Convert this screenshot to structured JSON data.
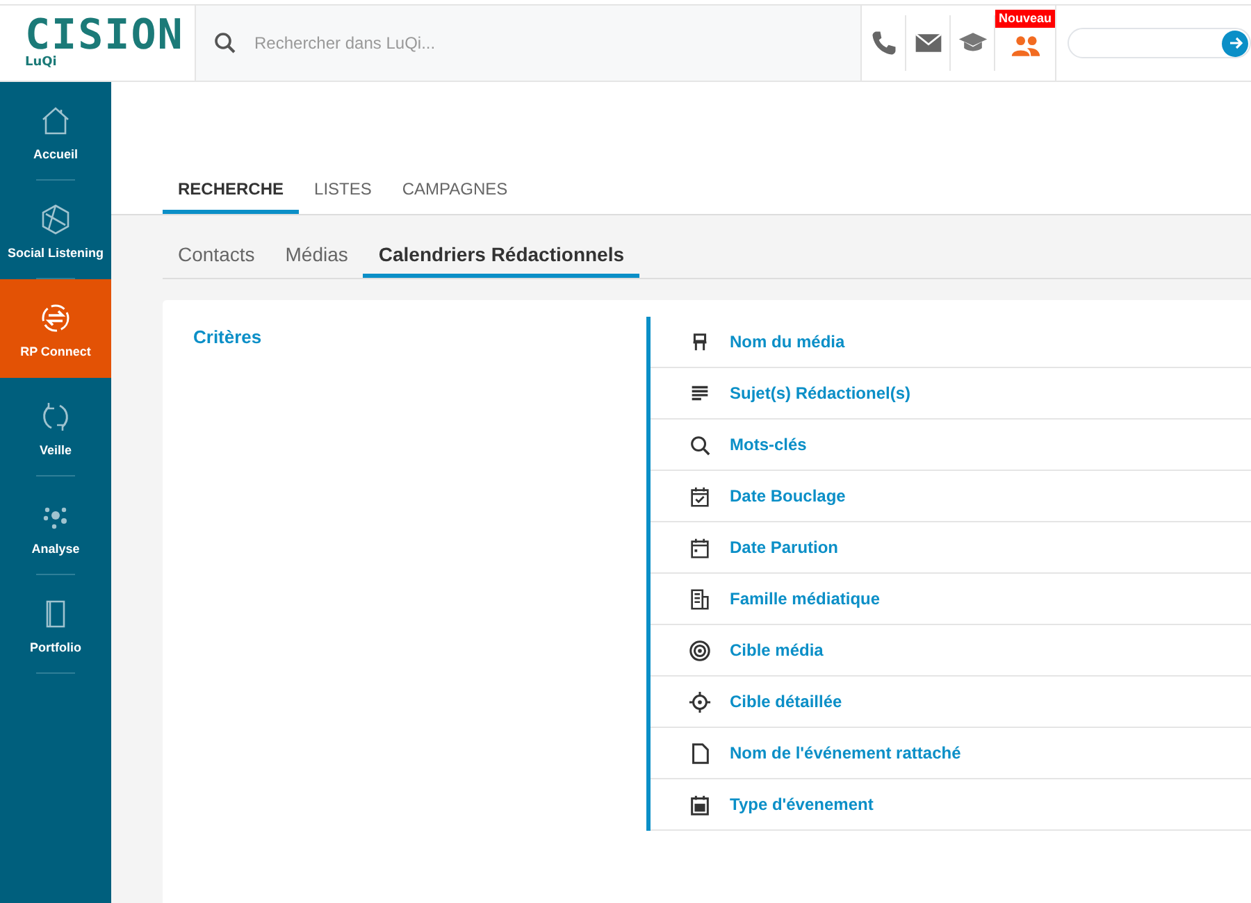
{
  "header": {
    "logo": "CISION",
    "logo_sub": "LuQi",
    "search": {
      "placeholder": "Rechercher dans LuQi..."
    },
    "badge": "Nouveau"
  },
  "sidebar": {
    "items": [
      {
        "label": "Accueil",
        "selected": false
      },
      {
        "label": "Social Listening",
        "selected": false
      },
      {
        "label": "RP Connect",
        "selected": true
      },
      {
        "label": "Veille",
        "selected": false
      },
      {
        "label": "Analyse",
        "selected": false
      },
      {
        "label": "Portfolio",
        "selected": false
      }
    ]
  },
  "tabs": [
    {
      "label": "RECHERCHE",
      "selected": true
    },
    {
      "label": "LISTES",
      "selected": false
    },
    {
      "label": "CAMPAGNES",
      "selected": false
    }
  ],
  "subtabs": [
    {
      "label": "Contacts",
      "selected": false
    },
    {
      "label": "Médias",
      "selected": false
    },
    {
      "label": "Calendriers Rédactionnels",
      "selected": true
    }
  ],
  "criteria": {
    "title": "Critères",
    "items": [
      {
        "label": "Nom du média"
      },
      {
        "label": "Sujet(s) Rédactionel(s)"
      },
      {
        "label": "Mots-clés"
      },
      {
        "label": "Date Bouclage"
      },
      {
        "label": "Date Parution"
      },
      {
        "label": "Famille médiatique"
      },
      {
        "label": "Cible média"
      },
      {
        "label": "Cible détaillée"
      },
      {
        "label": "Nom de l'événement rattaché"
      },
      {
        "label": "Type d'évenement"
      }
    ]
  }
}
